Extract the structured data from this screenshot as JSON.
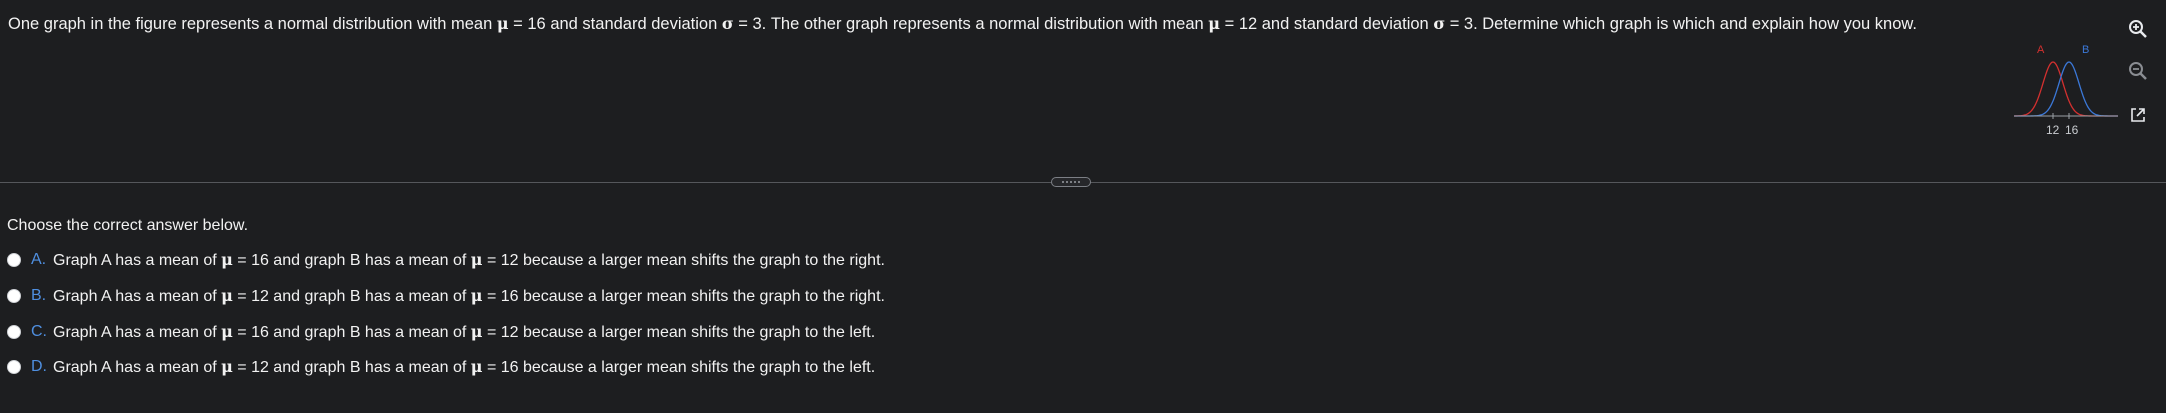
{
  "question": {
    "p1": "One graph in the figure represents a normal distribution with mean ",
    "mu": "μ",
    "p2": " = 16 and standard deviation ",
    "sigma": "σ",
    "p3": " = 3. The other graph represents a normal distribution with mean ",
    "p4": " = 12 and standard deviation ",
    "p5": " = 3. Determine which graph is which and explain how you know."
  },
  "figure": {
    "label_a": "A",
    "label_b": "B",
    "tick_12": "12",
    "tick_16": "16",
    "color_a": "#d3302f",
    "color_b": "#3b78d8"
  },
  "tools": [
    "zoom-in-icon",
    "zoom-out-icon",
    "open-new-window-icon"
  ],
  "prompt": "Choose the correct answer below.",
  "options": [
    {
      "letter": "A.",
      "t1": "Graph A has a mean of ",
      "mu": "μ",
      "t2": " = 16 and graph B has a mean of ",
      "t3": " = 12 because a larger mean shifts the graph to the right."
    },
    {
      "letter": "B.",
      "t1": "Graph A has a mean of ",
      "mu": "μ",
      "t2": " = 12 and graph B has a mean of ",
      "t3": " = 16 because a larger mean shifts the graph to the right."
    },
    {
      "letter": "C.",
      "t1": "Graph A has a mean of ",
      "mu": "μ",
      "t2": " = 16 and graph B has a mean of ",
      "t3": " = 12 because a larger mean shifts the graph to the left."
    },
    {
      "letter": "D.",
      "t1": "Graph A has a mean of ",
      "mu": "μ",
      "t2": " = 12 and graph B has a mean of ",
      "t3": " = 16 because a larger mean shifts the graph to the left."
    }
  ]
}
